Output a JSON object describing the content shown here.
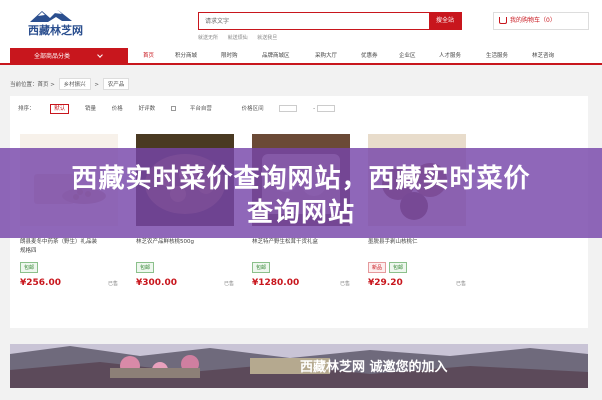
{
  "header": {
    "logo_text": "西藏林芝网",
    "search_value": "请求文字",
    "search_button": "搜全站",
    "hot_links": [
      "就送无所",
      "就送烦仙",
      "就送我旦"
    ],
    "cart_label": "我的购物车（0）"
  },
  "nav": {
    "category_button": "全部商品分类",
    "items": [
      "首页",
      "积分商城",
      "限时购",
      "品牌商城区",
      "采购大厅",
      "优惠券",
      "企业区",
      "人才服务",
      "生活服务",
      "林芝咨询"
    ]
  },
  "breadcrumb": {
    "label": "当前位置：",
    "home": "首页",
    "level1": "乡村振兴",
    "level2": "农产品"
  },
  "filters": {
    "label": "排序：",
    "default": "默认",
    "sales": "销量",
    "price": "价格",
    "rating": "好评数",
    "self_operated": "平台自营",
    "price_range": "价格区间"
  },
  "products": [
    {
      "title": "朗县麦冬中药茶（野生）礼品装",
      "subtitle": "规格四",
      "badges": [
        "包邮"
      ],
      "badge_red": [
        false
      ],
      "price": "¥256.00",
      "unit": "已售"
    },
    {
      "title": "林芝农产品鲜核桃500g",
      "subtitle": "",
      "badges": [
        "包邮"
      ],
      "badge_red": [
        false
      ],
      "price": "¥300.00",
      "unit": "已售"
    },
    {
      "title": "林芝特产野生松茸干货礼盒",
      "subtitle": "",
      "badges": [
        "包邮"
      ],
      "badge_red": [
        false
      ],
      "price": "¥1280.00",
      "unit": "已售"
    },
    {
      "title": "墨脱县手剥山核桃仁",
      "subtitle": "",
      "badges": [
        "新品",
        "包邮"
      ],
      "badge_red": [
        true,
        false
      ],
      "price": "¥29.20",
      "unit": "已售"
    }
  ],
  "overlay": {
    "line1": "西藏实时菜价查询网站，西藏实时菜价",
    "line2": "查询网站"
  },
  "banner": {
    "text": "西藏林芝网 诚邀您的加入"
  },
  "colors": {
    "brand_red": "#c8161d",
    "overlay_purple": "#7646aa",
    "logo_blue": "#2b4f8f"
  }
}
